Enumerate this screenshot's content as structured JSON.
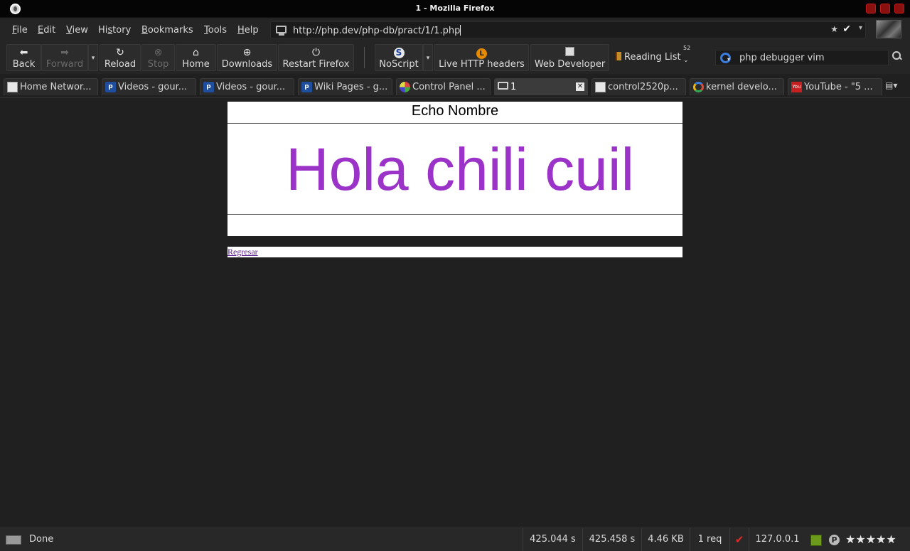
{
  "window": {
    "title": "1 - Mozilla Firefox"
  },
  "menubar": {
    "items": [
      "File",
      "Edit",
      "View",
      "History",
      "Bookmarks",
      "Tools",
      "Help"
    ],
    "access_keys": [
      "F",
      "E",
      "V",
      "s",
      "B",
      "T",
      "H"
    ]
  },
  "urlbar": {
    "url": "http://php.dev/php-db/pract/1/1.php"
  },
  "toolbar": {
    "back": "Back",
    "forward": "Forward",
    "reload": "Reload",
    "stop": "Stop",
    "home": "Home",
    "downloads": "Downloads",
    "restart": "Restart Firefox",
    "noscript": "NoScript",
    "live_http": "Live HTTP headers",
    "web_developer": "Web Developer",
    "reading_list": "Reading List",
    "reading_count": "52"
  },
  "search": {
    "value": "php debugger vim"
  },
  "tabs": [
    {
      "label": "Home Networ...",
      "icon": "document-icon",
      "active": false
    },
    {
      "label": "Videos - gour...",
      "icon": "p-icon",
      "active": false
    },
    {
      "label": "Videos - gour...",
      "icon": "p-icon",
      "active": false
    },
    {
      "label": "Wiki Pages - g...",
      "icon": "p-icon",
      "active": false
    },
    {
      "label": "Control Panel ...",
      "icon": "control-panel-icon",
      "active": false
    },
    {
      "label": "1",
      "icon": "laptop-icon",
      "active": true
    },
    {
      "label": "control2520p...",
      "icon": "document-icon",
      "active": false
    },
    {
      "label": "kernel develo...",
      "icon": "google-icon",
      "active": false
    },
    {
      "label": "YouTube - \"5 ...",
      "icon": "youtube-icon",
      "active": false
    }
  ],
  "page": {
    "header": "Echo Nombre",
    "greeting": "Hola chili cuil",
    "greeting_color": "#9c33c9",
    "back_link": "Regresar"
  },
  "statusbar": {
    "status": "Done",
    "time1": "425.044 s",
    "time2": "425.458 s",
    "size": "4.46 KB",
    "requests": "1 req",
    "ip": "127.0.0.1",
    "stars": "★★★★★"
  }
}
